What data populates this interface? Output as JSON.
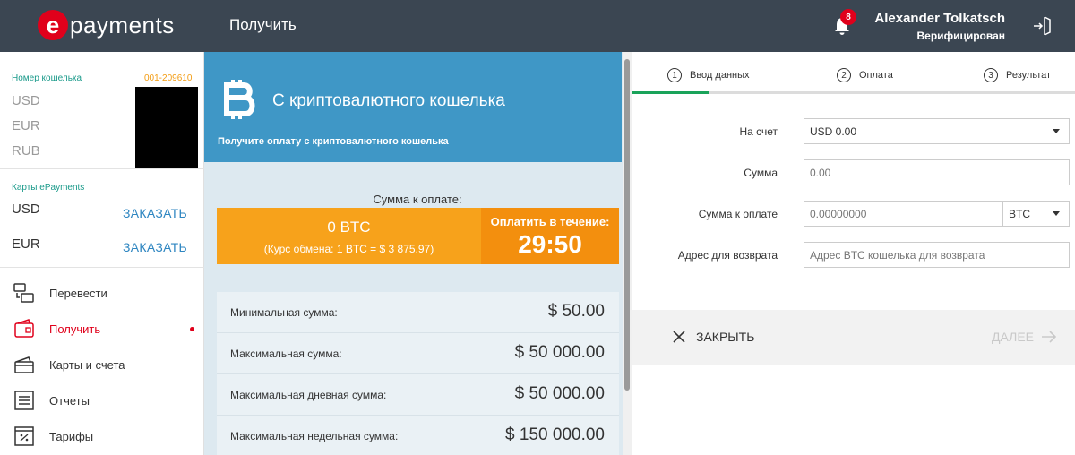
{
  "header": {
    "logo_letter": "e",
    "logo_text": "payments",
    "title": "Получить",
    "notification_count": "8",
    "user_name": "Alexander Tolkatsch",
    "user_status": "Верифицирован"
  },
  "sidebar": {
    "wallet_label": "Номер кошелька",
    "wallet_number": "001-209610",
    "currencies": [
      "USD",
      "EUR",
      "RUB"
    ],
    "cards_label": "Карты ePayments",
    "cards": [
      {
        "currency": "USD",
        "action": "ЗАКАЗАТЬ"
      },
      {
        "currency": "EUR",
        "action": "ЗАКАЗАТЬ"
      }
    ],
    "nav": [
      {
        "label": "Перевести",
        "icon": "transfer-icon"
      },
      {
        "label": "Получить",
        "icon": "receive-wallet-icon",
        "active": true
      },
      {
        "label": "Карты и счета",
        "icon": "cards-icon"
      },
      {
        "label": "Отчеты",
        "icon": "reports-icon"
      },
      {
        "label": "Тарифы",
        "icon": "tariffs-icon"
      }
    ]
  },
  "payment_panel": {
    "title": "С криптовалютного кошелька",
    "subtitle": "Получите оплату с криптовалютного кошелька",
    "sum_label": "Сумма к оплате:",
    "amount": "0 BTC",
    "rate": "(Курс обмена: 1 BTC = $ 3 875.97)",
    "timer_label": "Оплатить в течение:",
    "timer_value": "29:50",
    "limits": [
      {
        "label": "Минимальная сумма:",
        "value": "$ 50.00"
      },
      {
        "label": "Максимальная сумма:",
        "value": "$ 50 000.00"
      },
      {
        "label": "Максимальная дневная сумма:",
        "value": "$ 50 000.00"
      },
      {
        "label": "Максимальная недельная сумма:",
        "value": "$ 150 000.00"
      }
    ]
  },
  "form": {
    "steps": [
      {
        "num": "1",
        "label": "Ввод данных"
      },
      {
        "num": "2",
        "label": "Оплата"
      },
      {
        "num": "3",
        "label": "Результат"
      }
    ],
    "account_label": "На счет",
    "account_value": "USD 0.00",
    "amount_label": "Сумма",
    "amount_placeholder": "0.00",
    "pay_label": "Сумма к оплате",
    "pay_placeholder": "0.00000000",
    "pay_currency": "BTC",
    "refund_label": "Адрес для возврата",
    "refund_placeholder": "Адрес BTC кошелька для возврата",
    "close_label": "ЗАКРЫТЬ",
    "next_label": "ДАЛЕЕ"
  },
  "colors": {
    "header_bg": "#3b4652",
    "brand_red": "#e0001b",
    "panel_blue": "#3f97c6",
    "pay_orange": "#f7a21b",
    "timer_orange": "#f38f0e",
    "progress_green": "#1aa35a",
    "link_blue": "#2e86c1"
  }
}
